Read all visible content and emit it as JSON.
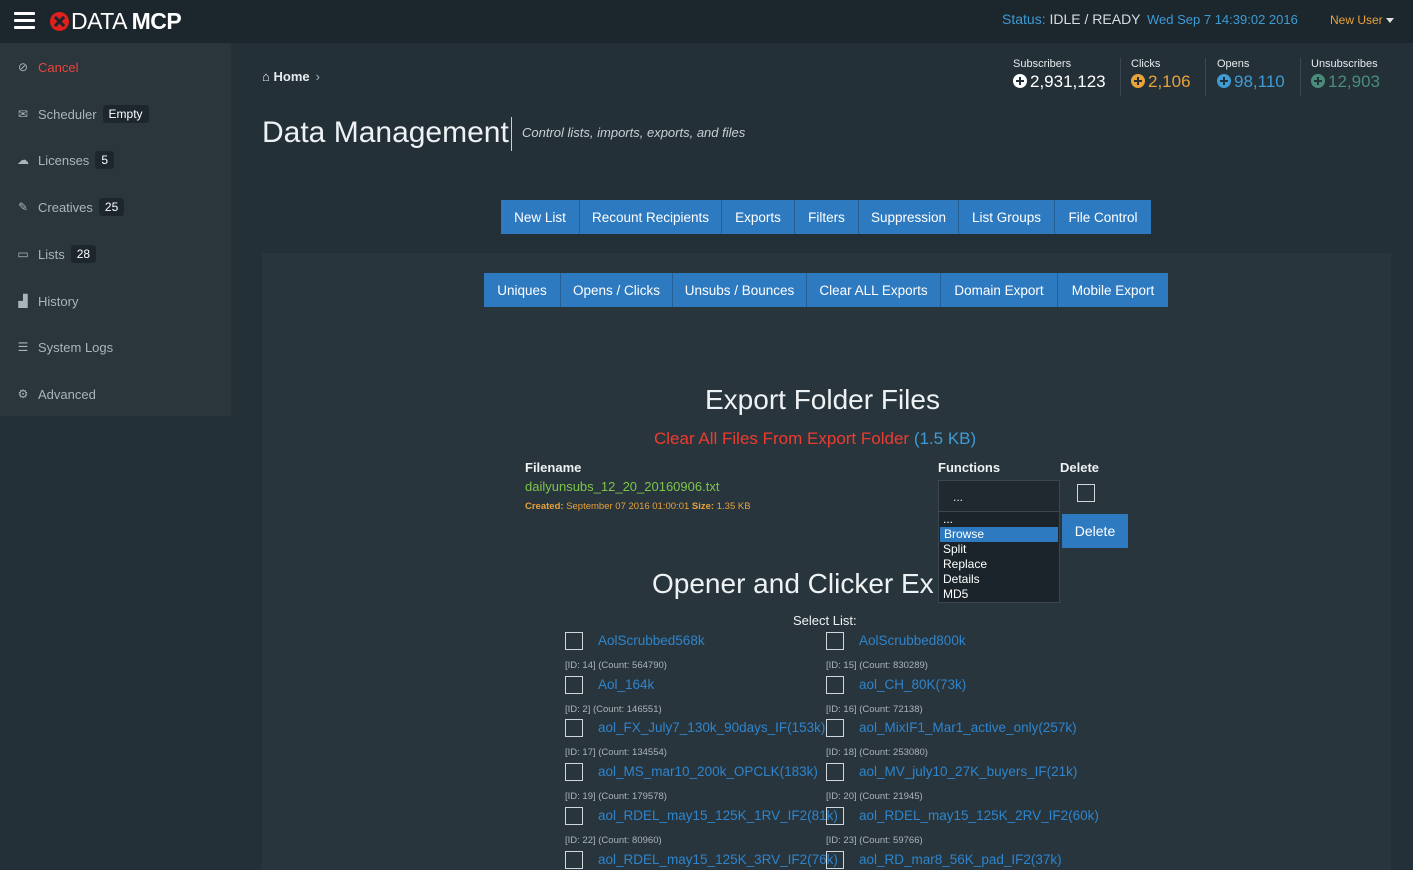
{
  "header": {
    "logo_text": "DATA",
    "logo_bold": "MCP",
    "status_label": "Status:",
    "status_value": "IDLE / READY",
    "datetime": "Wed Sep 7 14:39:02 2016",
    "user": "New User"
  },
  "sidebar": {
    "items": [
      {
        "label": "Cancel",
        "icon": "ban-icon"
      },
      {
        "label": "Scheduler",
        "icon": "envelope-icon",
        "badge": "Empty"
      },
      {
        "label": "Licenses",
        "icon": "cloud-icon",
        "badge": "5"
      },
      {
        "label": "Creatives",
        "icon": "edit-icon",
        "badge": "25"
      },
      {
        "label": "Lists",
        "icon": "folder-icon",
        "badge": "28"
      },
      {
        "label": "History",
        "icon": "bar-chart-icon"
      },
      {
        "label": "System Logs",
        "icon": "list-icon"
      },
      {
        "label": "Advanced",
        "icon": "cogs-icon"
      }
    ]
  },
  "breadcrumb": {
    "home": "Home"
  },
  "page": {
    "title": "Data Management",
    "subtitle": "Control lists, imports, exports, and files"
  },
  "stats": [
    {
      "label": "Subscribers",
      "value": "2,931,123",
      "color": "#ffffff"
    },
    {
      "label": "Clicks",
      "value": "2,106",
      "color": "#e8a23a"
    },
    {
      "label": "Opens",
      "value": "98,110",
      "color": "#3e9bd4"
    },
    {
      "label": "Unsubscribes",
      "value": "12,903",
      "color": "#4a8c7a"
    }
  ],
  "main_tabs": [
    "New List",
    "Recount Recipients",
    "Exports",
    "Filters",
    "Suppression",
    "List Groups",
    "File Control"
  ],
  "export_tabs": [
    "Uniques",
    "Opens / Clicks",
    "Unsubs / Bounces",
    "Clear ALL Exports",
    "Domain Export",
    "Mobile Export"
  ],
  "export_files": {
    "title": "Export Folder Files",
    "clear_text": "Clear All Files From Export Folder",
    "clear_size": "(1.5 KB)",
    "col_filename": "Filename",
    "col_functions": "Functions",
    "col_delete": "Delete",
    "file": {
      "name": "dailyunsubs_12_20_20160906.txt",
      "created_label": "Created:",
      "created_value": "September 07 2016 01:00:01",
      "size_label": "Size:",
      "size_value": "1.35 KB"
    },
    "function_selected": "...",
    "function_options": [
      "...",
      "Browse",
      "Split",
      "Replace",
      "Details",
      "MD5"
    ],
    "function_highlight_index": 1,
    "delete_button": "Delete"
  },
  "opener_section": {
    "title": "Opener and Clicker Ex",
    "select_label": "Select List:",
    "lists": [
      {
        "name": "AolScrubbed568k",
        "meta": "[ID: 14] (Count: 564790)"
      },
      {
        "name": "AolScrubbed800k",
        "meta": "[ID: 15] (Count: 830289)"
      },
      {
        "name": "Aol_164k",
        "meta": "[ID: 2] (Count: 146551)"
      },
      {
        "name": "aol_CH_80K(73k)",
        "meta": "[ID: 16] (Count: 72138)"
      },
      {
        "name": "aol_FX_July7_130k_90days_IF(153k)",
        "meta": "[ID: 17] (Count: 134554)"
      },
      {
        "name": "aol_MixIF1_Mar1_active_only(257k)",
        "meta": "[ID: 18] (Count: 253080)"
      },
      {
        "name": "aol_MS_mar10_200k_OPCLK(183k)",
        "meta": "[ID: 19] (Count: 179578)"
      },
      {
        "name": "aol_MV_july10_27K_buyers_IF(21k)",
        "meta": "[ID: 20] (Count: 21945)"
      },
      {
        "name": "aol_RDEL_may15_125K_1RV_IF2(81k)",
        "meta": "[ID: 22] (Count: 80960)"
      },
      {
        "name": "aol_RDEL_may15_125K_2RV_IF2(60k)",
        "meta": "[ID: 23] (Count: 59766)"
      },
      {
        "name": "aol_RDEL_may15_125K_3RV_IF2(76k)",
        "meta": ""
      },
      {
        "name": "aol_RD_mar8_56K_pad_IF2(37k)",
        "meta": ""
      }
    ]
  }
}
